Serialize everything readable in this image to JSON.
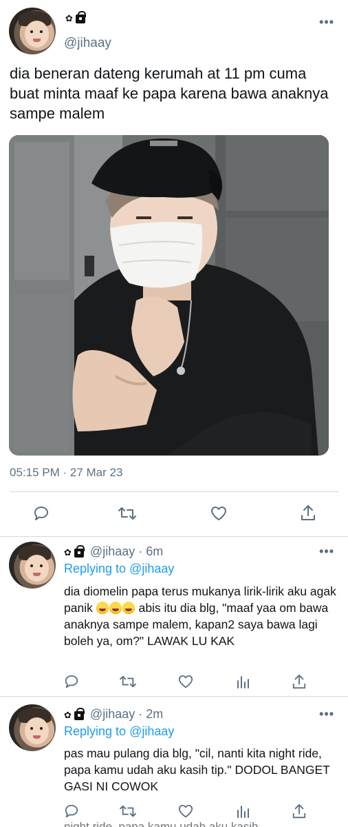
{
  "main_tweet": {
    "badges": [
      "✿",
      "bag-lock"
    ],
    "handle": "@jihaay",
    "text": "dia beneran dateng kerumah at 11 pm cuma buat minta maaf ke papa karena bawa anaknya sampe malem",
    "timestamp": "05:15 PM · 27 Mar 23",
    "photo_description_icon": "photo"
  },
  "replies": [
    {
      "handle": "@jihaay",
      "time": "6m",
      "replying_label": "Replying to",
      "replying_to": "@jihaay",
      "text_before_emoji": "dia diomelin papa terus mukanya lirik-lirik aku agak panik",
      "emoji_count": 3,
      "text_after_emoji": " abis itu dia blg, \"maaf yaa om bawa anaknya sampe malem, kapan2 saya bawa lagi boleh ya, om?\" LAWAK LU KAK"
    },
    {
      "handle": "@jihaay",
      "time": "2m",
      "replying_label": "Replying to",
      "replying_to": "@jihaay",
      "text": "pas mau pulang dia blg, \"cil, nanti kita night ride, papa kamu udah aku kasih tip.\" DODOL BANGET GASI NI COWOK"
    }
  ],
  "peek_text": "night ride, papa kamu udah aku kasih",
  "colors": {
    "link": "#1d9bf0",
    "secondary": "#5b7083",
    "divider": "#cfd9de"
  }
}
